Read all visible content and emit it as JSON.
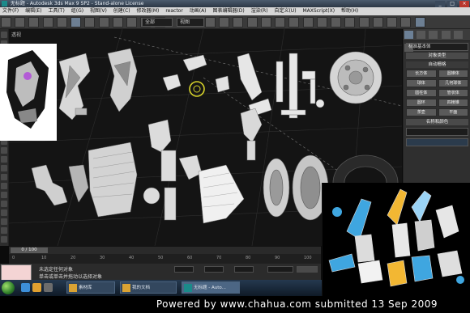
{
  "window": {
    "title": "无标题 - Autodesk 3ds Max 9 SP2 - Stand-alone License",
    "buttons": [
      "_",
      "□",
      "×"
    ]
  },
  "menu": {
    "items": [
      "文件(F)",
      "编辑(E)",
      "工具(T)",
      "组(G)",
      "视图(V)",
      "创建(C)",
      "修改器(M)",
      "reactor",
      "动画(A)",
      "图表编辑器(D)",
      "渲染(R)",
      "自定义(U)",
      "MAXScript(X)",
      "帮助(H)"
    ]
  },
  "toolbar": {
    "selection_filter": "全部",
    "coord_system": "视图"
  },
  "viewport": {
    "label": "透视"
  },
  "command_panel": {
    "category": "标准基本体",
    "rollout_object_type": "对象类型",
    "autogrid": "自动栅格",
    "object_buttons": [
      "长方体",
      "圆锥体",
      "球体",
      "几何球体",
      "圆柱体",
      "管状体",
      "圆环",
      "四棱锥",
      "茶壶",
      "平面"
    ],
    "rollout_name_color": "名称和颜色"
  },
  "timeline": {
    "slider": "0 / 100",
    "ticks": [
      "0",
      "10",
      "20",
      "30",
      "40",
      "50",
      "60",
      "70",
      "80",
      "90",
      "100"
    ]
  },
  "status": {
    "line1": "未选定任何对象",
    "line2": "单击或单击并拖动以选择对象"
  },
  "taskbar": {
    "items": [
      "素材库",
      "我的文档",
      "无标题 - Auto..."
    ]
  },
  "watermark": "Powered  by  www.chahua.com  submitted  13  Sep  2009"
}
